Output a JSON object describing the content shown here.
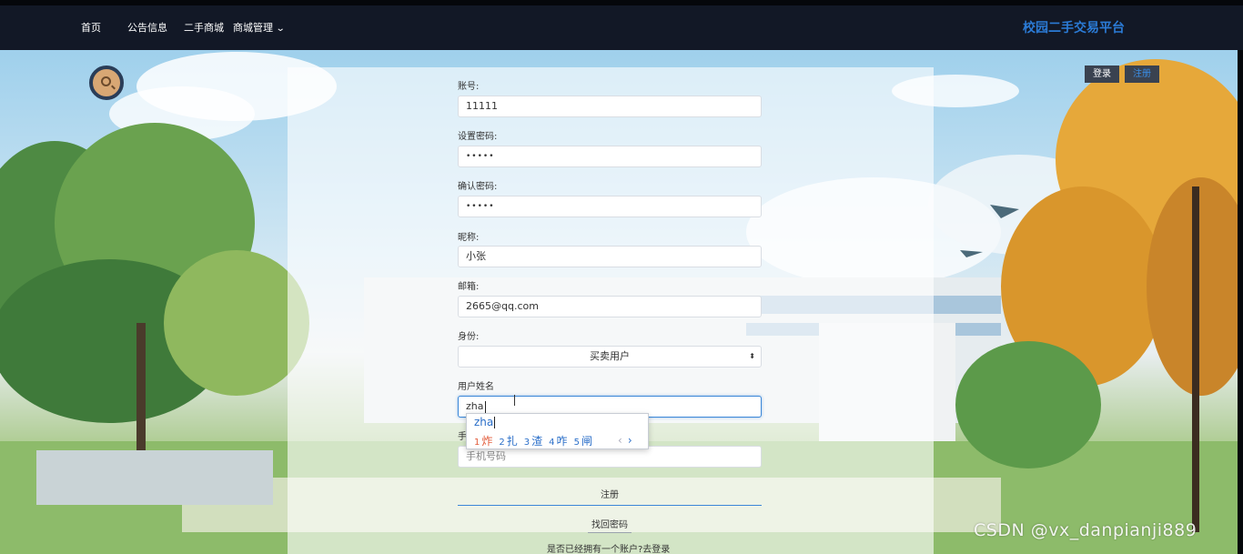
{
  "nav": {
    "home": "首页",
    "notice": "公告信息",
    "mall": "二手商城",
    "manage": "商城管理",
    "brand": "校园二手交易平台"
  },
  "auth": {
    "login": "登录",
    "register": "注册"
  },
  "form": {
    "account_label": "账号:",
    "account_value": "11111",
    "password_label": "设置密码:",
    "password_value": "•••••",
    "confirm_label": "确认密码:",
    "confirm_value": "•••••",
    "nickname_label": "昵称:",
    "nickname_value": "小张",
    "email_label": "邮箱:",
    "email_value": "2665@qq.com",
    "role_label": "身份:",
    "role_value": "买卖用户",
    "realname_label": "用户姓名",
    "realname_value": "zha",
    "phone_label": "手",
    "phone_placeholder": "手机号码",
    "submit": "注册",
    "reset_link": "找回密码",
    "login_link": "是否已经拥有一个账户?去登录"
  },
  "ime": {
    "composition": "zha",
    "candidates": [
      {
        "num": "1",
        "char": "炸"
      },
      {
        "num": "2",
        "char": "扎"
      },
      {
        "num": "3",
        "char": "渣"
      },
      {
        "num": "4",
        "char": "咋"
      },
      {
        "num": "5",
        "char": "闸"
      }
    ],
    "prev": "‹",
    "next": "›"
  },
  "watermark": "CSDN @vx_danpianji889",
  "icons": {
    "search": "search-icon",
    "select_arrow": "updown-arrow-icon",
    "chevron": "chevron-down-icon"
  },
  "colors": {
    "brand": "#2b7bd6",
    "navbar": "#121826",
    "accent": "#3b87d8"
  }
}
